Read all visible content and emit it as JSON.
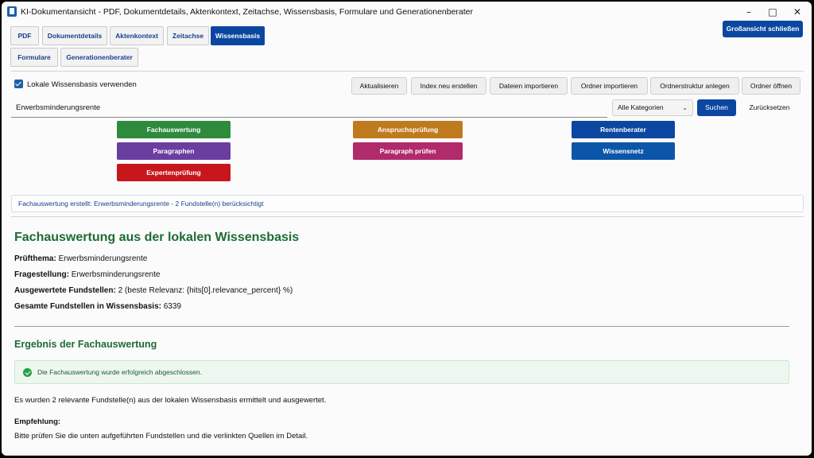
{
  "window": {
    "title": "KI-Dokumentansicht - PDF, Dokumentdetails, Aktenkontext, Zeitachse, Wissensbasis, Formulare und Generationenberater",
    "minimize": "–",
    "maximize": "□",
    "close": "✕",
    "close_large_view": "Großansicht schließen"
  },
  "tabs": [
    {
      "label": "PDF",
      "active": false
    },
    {
      "label": "Dokumentdetails",
      "active": false
    },
    {
      "label": "Aktenkontext",
      "active": false
    },
    {
      "label": "Zeitachse",
      "active": false
    },
    {
      "label": "Wissensbasis",
      "active": true
    },
    {
      "label": "Formulare",
      "active": false
    },
    {
      "label": "Generationenberater",
      "active": false
    }
  ],
  "toolbar": {
    "use_local_kb": {
      "label": "Lokale Wissensbasis verwenden",
      "checked": true
    },
    "buttons": [
      "Aktualisieren",
      "Index neu erstellen",
      "Dateien importieren",
      "Ordner importieren",
      "Ordnerstruktur anlegen",
      "Ordner öffnen"
    ]
  },
  "search": {
    "value": "Erwerbsminderungsrente",
    "category": "Alle Kategorien",
    "search_button": "Suchen",
    "reset_button": "Zurücksetzen"
  },
  "actions": [
    {
      "label": "Fachauswertung",
      "color": "#2e8b3e"
    },
    {
      "label": "Anspruchsprüfung",
      "color": "#c07a1e"
    },
    {
      "label": "Rentenberater",
      "color": "#0b47a1"
    },
    {
      "label": "Paragraphen",
      "color": "#6a3ea1"
    },
    {
      "label": "Paragraph prüfen",
      "color": "#b12a6c"
    },
    {
      "label": "Wissensnetz",
      "color": "#0b56a8"
    },
    {
      "label": "Expertenprüfung",
      "color": "#c8161d"
    }
  ],
  "status": "Fachauswertung erstellt: Erwerbsminderungsrente - 2 Fundstelle(n) berücksichtigt",
  "report": {
    "heading": "Fachauswertung aus der lokalen Wissensbasis",
    "topic_label": "Prüfthema:",
    "topic_value": "Erwerbsminderungsrente",
    "question_label": "Fragestellung:",
    "question_value": "Erwerbsminderungsrente",
    "evaluated_label": "Ausgewertete Fundstellen:",
    "evaluated_value": "2 (beste Relevanz: {hits[0].relevance_percent} %)",
    "total_label": "Gesamte Fundstellen in Wissensbasis:",
    "total_value": "6339",
    "result_heading": "Ergebnis der Fachauswertung",
    "success_message": "Die Fachauswertung wurde erfolgreich abgeschlossen.",
    "summary": "Es wurden 2 relevante Fundstelle(n) aus der lokalen Wissensbasis ermittelt und ausgewertet.",
    "recommendation_label": "Empfehlung:",
    "recommendation_text": "Bitte prüfen Sie die unten aufgeführten Fundstellen und die verlinkten Quellen im Detail."
  },
  "colors": {
    "accent": "#0b47a1",
    "heading_green": "#1e6b35",
    "success_bg": "#edf7ef"
  }
}
